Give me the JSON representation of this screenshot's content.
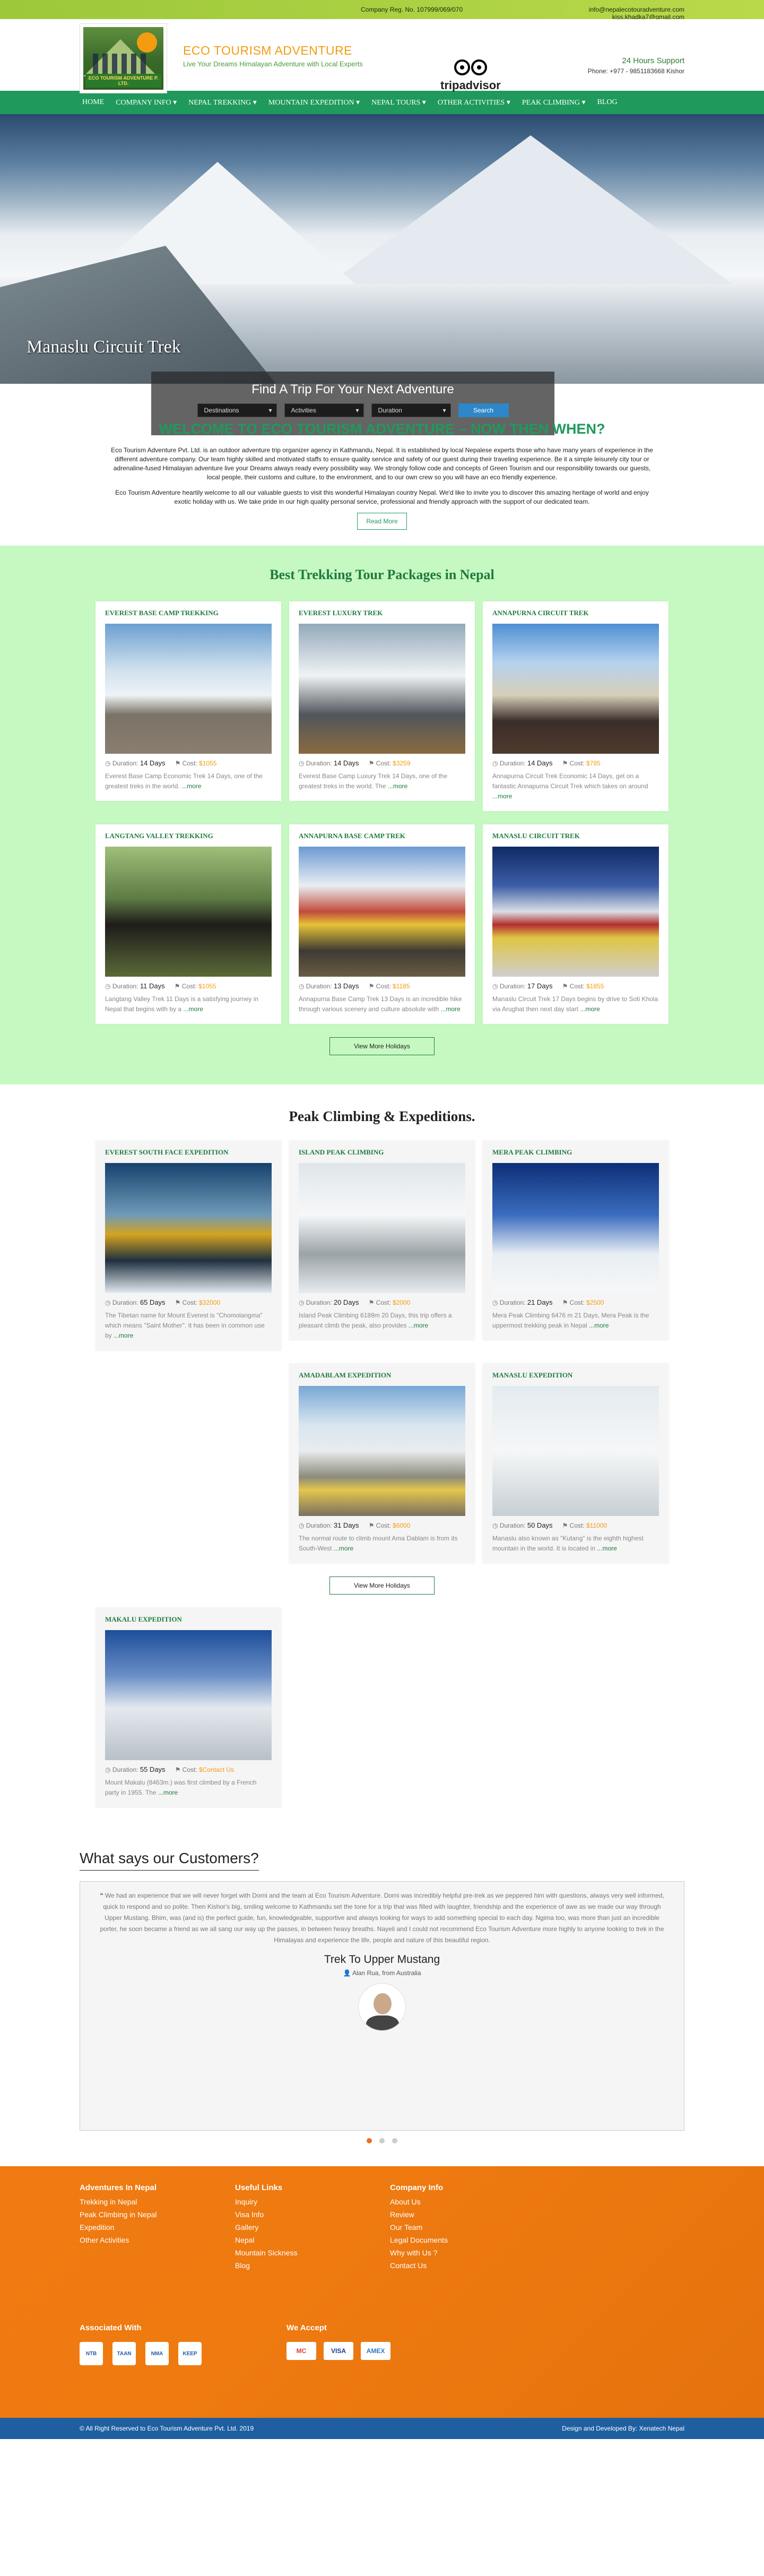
{
  "topbar": {
    "registration": "Company Reg. No. 107999/069/070",
    "emails": "info@nepalecotouradventure.com\nkiss.khadka7@gmail.com"
  },
  "header": {
    "logo_text": "ECO TOURISM ADVENTURE P. LTD.",
    "brand_name": "ECO TOURISM ADVENTURE",
    "tagline": "Live Your Dreams Himalayan Adventure with Local Experts",
    "tripadvisor": "tripadvisor",
    "support_title": "24 Hours Support",
    "support_phone": "Phone: +977 - 9851183668 Kishor"
  },
  "nav": [
    "HOME",
    "COMPANY INFO ▾",
    "NEPAL TREKKING ▾",
    "MOUNTAIN EXPEDITION ▾",
    "NEPAL TOURS ▾",
    "OTHER ACTIVITIES ▾",
    "PEAK CLIMBING ▾",
    "BLOG"
  ],
  "hero": {
    "caption": "Manaslu Circuit Trek"
  },
  "finder": {
    "title": "Find A Trip For Your Next Adventure",
    "selects": [
      "Destinations",
      "Activities",
      "Duration"
    ],
    "search_label": "Search"
  },
  "welcome": {
    "heading": "WELCOME TO ECO TOURISM ADVENTURE – NOW THEN WHEN?",
    "para1": "Eco Tourism Adventure Pvt. Ltd. is an outdoor adventure trip organizer agency in Kathmandu, Nepal. It is established by local Nepalese experts those who have many years of experience in the different adventure company. Our team highly skilled and motivated staffs to ensure quality service and safety of our guest during their traveling experience. Be it a simple leisurely city tour or adrenaline-fused Himalayan adventure live your Dreams always ready every possibility way. We strongly follow code and concepts of Green Tourism and our responsibility towards our guests, local people, their customs and culture, to the environment, and to our own crew so you will have an eco friendly experience.",
    "para2": "Eco Tourism Adventure heartily welcome to all our valuable guests to visit this wonderful Himalayan country Nepal. We'd like to invite you to discover this amazing heritage of world and enjoy exotic holiday with us. We take pride in our high quality personal service, professional and friendly approach with the support of our dedicated team.",
    "read_more": "Read More"
  },
  "trekking": {
    "title": "Best Trekking Tour Packages in Nepal",
    "duration_label": "Duration:",
    "cost_label": "Cost:",
    "more_label": "...more",
    "view_more": "View More Holidays",
    "cards": [
      {
        "title": "EVEREST BASE CAMP TREKKING",
        "days": "14 Days",
        "cost": "$1055",
        "desc": "Everest Base Camp Economic Trek 14 Days, one of the greatest treks in the world."
      },
      {
        "title": "EVEREST LUXURY TREK",
        "days": "14 Days",
        "cost": "$3259",
        "desc": "Everest Base Camp Luxury Trek 14 Days, one of the greatest treks in the world. The"
      },
      {
        "title": "ANNAPURNA CIRCUIT TREK",
        "days": "14 Days",
        "cost": "$785",
        "desc": "Annapurna Circuit Trek Economic 14 Days, get on a fantastic Annapurna Circuit Trek which takes on around"
      },
      {
        "title": "LANGTANG VALLEY TREKKING",
        "days": "11 Days",
        "cost": "$1055",
        "desc": "Langtang Valley Trek 11 Days is a satisfying journey in Nepal that begins with by a"
      },
      {
        "title": "ANNAPURNA BASE CAMP TREK",
        "days": "13 Days",
        "cost": "$1185",
        "desc": "Annapurna Base Camp Trek 13 Days is an incredible hike through various scenery and culture absolute with"
      },
      {
        "title": "MANASLU CIRCUIT TREK",
        "days": "17 Days",
        "cost": "$1855",
        "desc": "Manaslu Circuit Trek 17 Days begins by drive to Soti Khola via Arughat then next day start"
      }
    ]
  },
  "peaks": {
    "title": "Peak Climbing & Expeditions.",
    "view_more": "View More Holidays",
    "cards": [
      {
        "title": "EVEREST SOUTH FACE EXPEDITION",
        "days": "65 Days",
        "cost": "$32000",
        "desc": "The Tibetan name for Mount Everest is \"Chomolangma\" which means \"Saint Mother\". It has been in common use by"
      },
      {
        "title": "ISLAND PEAK CLIMBING",
        "days": "20 Days",
        "cost": "$2000",
        "desc": "Island Peak Climbing 6189m 20 Days, this trip offers a pleasant climb the peak, also provides"
      },
      {
        "title": "MERA PEAK CLIMBING",
        "days": "21 Days",
        "cost": "$2500",
        "desc": "Mera Peak Climbing 6476 m 21 Days, Mera Peak is the uppermost trekking peak in Nepal"
      },
      {
        "title": "AMADABLAM EXPEDITION",
        "days": "31 Days",
        "cost": "$6000",
        "desc": "The normal route to climb mount Ama Dablam is from its South-West"
      },
      {
        "title": "MANASLU EXPEDITION",
        "days": "50 Days",
        "cost": "$11000",
        "desc": "Manaslu also known as \"Kutang\" is the eighth highest mountain in the world. It is located in"
      },
      {
        "title": "MAKALU EXPEDITION",
        "days": "55 Days",
        "cost": "$Contact Us",
        "desc": "Mount Makalu (8463m.) was first climbed by a French party in 1955. The"
      }
    ]
  },
  "customers": {
    "title": "What says our Customers?",
    "quote": "We had an experience that we will never forget with Dorni and the team at Eco Tourism Adventure. Dorni was incredibly helpful pre-trek as we peppered him with questions, always very well informed, quick to respond and so polite. Then Kishor's big, smiling welcome to Kathmandu set the tone for a trip that was filled with laughter, friendship and the experience of awe as we made our way through Upper Mustang. Bhim, was (and is) the perfect guide, fun, knowledgeable, supportive and always looking for ways to add something special to each day. Ngima too, was more than just an incredible porter, he soon became a friend as we all sang our way up the passes, in between heavy breaths. Nayeli and I could not recommend Eco Tourism Adventure more highly to anyone looking to trek in the Himalayas and experience the life, people and nature of this beautiful region.",
    "trip_title": "Trek To Upper Mustang",
    "author": "Alan Rua, from Australia"
  },
  "footer": {
    "col1": {
      "title": "Adventures In Nepal",
      "items": [
        "Trekking in Nepal",
        "Peak Climbing in Nepal",
        "Expedition",
        "Other Activities"
      ]
    },
    "col2": {
      "title": "Useful Links",
      "items": [
        "Inquiry",
        "Visa Info",
        "Gallery",
        "Nepal",
        "Mountain Sickness",
        "Blog"
      ]
    },
    "col3": {
      "title": "Company Info",
      "items": [
        "About Us",
        "Review",
        "Our Team",
        "Legal Documents",
        "Why with Us ?",
        "Contact Us"
      ]
    },
    "assoc_title": "Associated With",
    "assoc": [
      "NTB",
      "TAAN",
      "NMA",
      "KEEP"
    ],
    "pay_title": "We Accept",
    "pay": [
      "MC",
      "VISA",
      "AMEX"
    ],
    "copyright": "© All Right Reserved to Eco Tourism Adventure Pvt. Ltd. 2019",
    "designed": "Design and Developed By: Xenatech Nepal"
  }
}
